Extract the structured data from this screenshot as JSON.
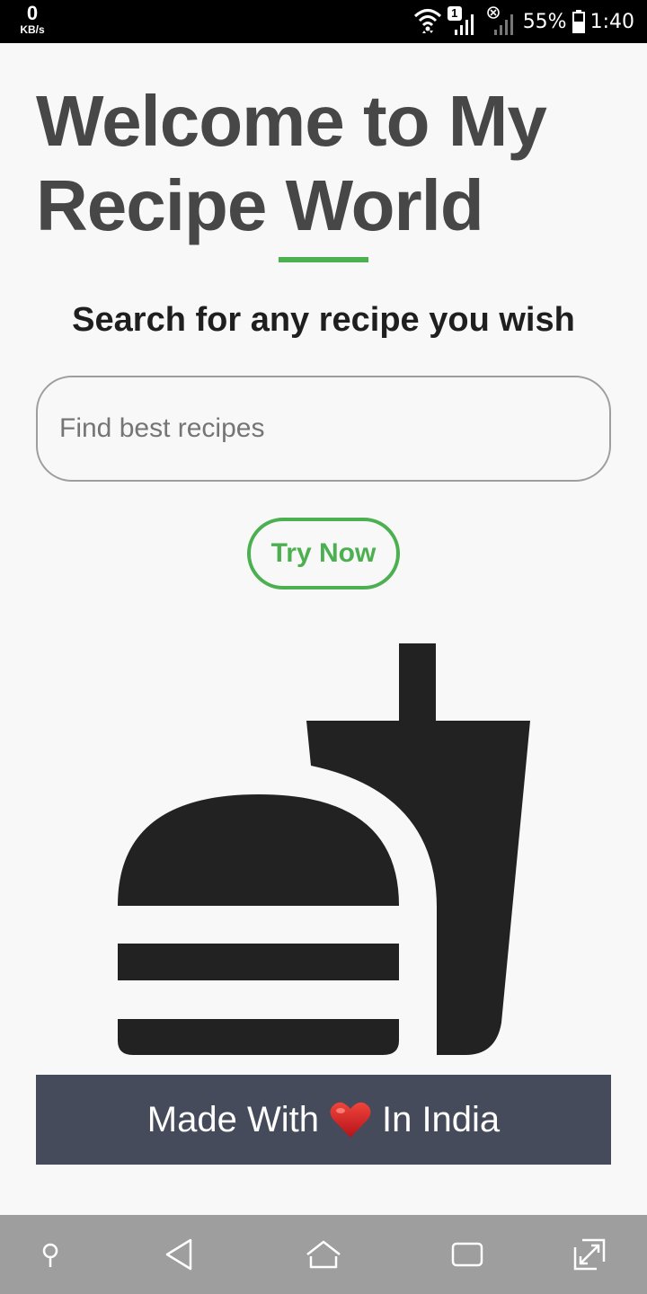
{
  "status_bar": {
    "net_speed_value": "0",
    "net_speed_unit": "KB/s",
    "sim_badge": "1",
    "battery_percent": "55%",
    "time": "1:40",
    "icons": [
      "wifi-icon",
      "signal-icon",
      "no-sim-signal-icon",
      "battery-icon"
    ]
  },
  "page": {
    "title": "Welcome to My Recipe World",
    "subtitle": "Search for any recipe you wish",
    "accent_color": "#4caf50"
  },
  "search": {
    "placeholder": "Find best recipes",
    "value": ""
  },
  "try_button": {
    "label": "Try Now"
  },
  "illustration": {
    "icon": "fastfood-icon"
  },
  "footer": {
    "text_before": "Made With",
    "text_after": "In India",
    "icon": "heart-icon",
    "background": "#454b5a"
  },
  "nav_bar": {
    "buttons": [
      "pin-icon",
      "back-icon",
      "home-icon",
      "recents-icon",
      "expand-icon"
    ]
  }
}
